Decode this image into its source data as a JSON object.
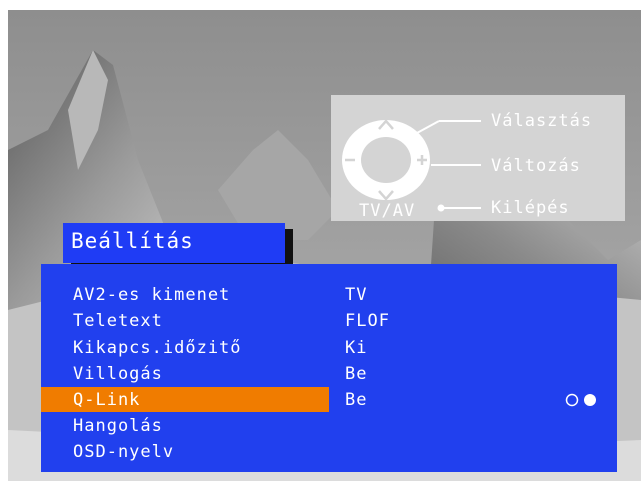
{
  "help": {
    "select_label": "Választás",
    "change_label": "Változás",
    "exit_label": "Kilépés",
    "tvav_label": "TV/AV"
  },
  "menu": {
    "title": "Beállítás",
    "items": [
      {
        "label": "AV2-es kimenet",
        "value": "TV"
      },
      {
        "label": "Teletext",
        "value": "FLOF"
      },
      {
        "label": "Kikapcs.időzitő",
        "value": "Ki"
      },
      {
        "label": "Villogás",
        "value": "Be"
      },
      {
        "label": "Q-Link",
        "value": "Be"
      },
      {
        "label": "Hangolás",
        "value": ""
      },
      {
        "label": "OSD-nyelv",
        "value": ""
      }
    ],
    "selected_index": 4
  },
  "colors": {
    "menu_blue": "#2140ee",
    "highlight_orange": "#f07c00",
    "help_panel_grey": "#d4d4d4"
  },
  "icons": {
    "remote_pad": "remote-dpad-icon",
    "page_dots": "page-indicator-dots"
  }
}
